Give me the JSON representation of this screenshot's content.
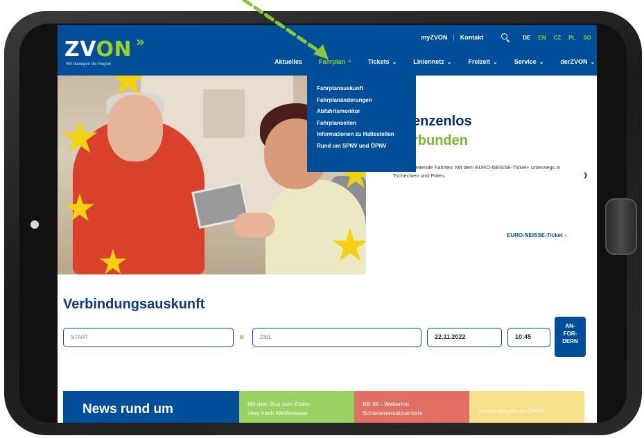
{
  "header": {
    "logo": {
      "zv": "ZV",
      "on": "ON",
      "chev": "»"
    },
    "tagline": "Wir bewegen die Region",
    "top_links": {
      "my": "myZVON",
      "sep": "|",
      "contact": "Kontakt"
    },
    "languages": [
      "DE",
      "EN",
      "CZ",
      "PL",
      "SO"
    ],
    "active_language": "EN",
    "main_nav": [
      {
        "label": "Aktuelles",
        "caret": ""
      },
      {
        "label": "Fahrplan",
        "caret": "^"
      },
      {
        "label": "Tickets",
        "caret": "⌄"
      },
      {
        "label": "Liniennetz",
        "caret": "⌄"
      },
      {
        "label": "Freizeit",
        "caret": "⌄"
      },
      {
        "label": "Service",
        "caret": "⌄"
      },
      {
        "label": "derZVON",
        "caret": "⌄"
      }
    ]
  },
  "dropdown": {
    "items": [
      "Fahrplanauskunft",
      "Fahrplanänderungen",
      "Abfahrtsmonitor",
      "Fahrplanseiten",
      "Informationen zu Haltestellen",
      "Rund um SPNV und ÖPNV"
    ]
  },
  "hero": {
    "title_line1": "enzenlos",
    "title_line2": "rbunden",
    "text": "züberschreitende Fahrten: Mit dem EURO-NEISSE-Ticket+ unterwegs in Tschechien und Polen.",
    "link": "EURO-NEISSE-Ticket",
    "link_arrow": "»",
    "prev": "‹",
    "next": "›"
  },
  "connection": {
    "title": "Verbindungsauskunft",
    "start_placeholder": "START",
    "ziel_placeholder": "ZIEL",
    "separator": "»",
    "date": "22.11.2022",
    "time": "10:45",
    "button_lines": [
      "AN-",
      "FOR-",
      "DERN"
    ]
  },
  "news": {
    "title": "News rund um",
    "items": [
      {
        "line1": "Mit dem Bus zum Eisho-",
        "line2": "ckey nach Weißwasser"
      },
      {
        "line1": "RB 65 - Weiterhin",
        "line2": "Schienenersatzverkehr"
      },
      {
        "line1": "Corona-Regeln im ÖPNV",
        "line2": ""
      }
    ]
  },
  "colors": {
    "brand_blue": "#004d9a",
    "brand_green": "#9bd026",
    "news_green": "#9ad163",
    "news_red": "#e07063",
    "news_yellow": "#f6e08a",
    "annotation": "#8cc63f"
  }
}
